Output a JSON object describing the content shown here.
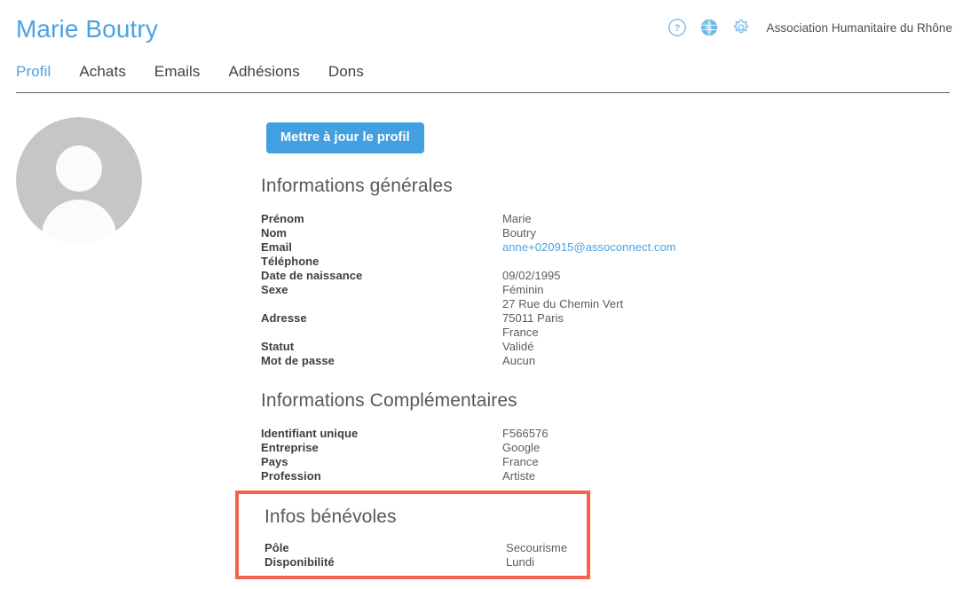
{
  "header": {
    "title": "Marie Boutry",
    "org_name": "Association Humanitaire du Rhône",
    "icons": [
      {
        "name": "help-icon",
        "label": "?"
      },
      {
        "name": "globe-icon",
        "label": "globe"
      },
      {
        "name": "gear-icon",
        "label": "settings"
      }
    ],
    "accent_color": "#4ba2e2",
    "divider_color": "#5a5a5a"
  },
  "tabs": [
    {
      "label": "Profil",
      "active": true
    },
    {
      "label": "Achats",
      "active": false
    },
    {
      "label": "Emails",
      "active": false
    },
    {
      "label": "Adhésions",
      "active": false
    },
    {
      "label": "Dons",
      "active": false
    }
  ],
  "avatar": {
    "name": "avatar-placeholder",
    "background_color": "#c6c6c6",
    "silhouette_color": "#ffffff"
  },
  "actions": {
    "update_profile_label": "Mettre à jour le profil",
    "button_color": "#43a0e0"
  },
  "sections": [
    {
      "id": "informations-generales",
      "title": "Informations générales",
      "fields": [
        {
          "label": "Prénom",
          "value": "Marie",
          "type": "text"
        },
        {
          "label": "Nom",
          "value": "Boutry",
          "type": "text"
        },
        {
          "label": "Email",
          "value": "anne+020915@assoconnect.com",
          "type": "link"
        },
        {
          "label": "Téléphone",
          "value": "",
          "type": "text"
        },
        {
          "label": "Date de naissance",
          "value": "09/02/1995",
          "type": "text"
        },
        {
          "label": "Sexe",
          "value": "Féminin",
          "type": "text"
        },
        {
          "label": "Adresse",
          "value": "27 Rue du Chemin Vert\n75011 Paris\nFrance",
          "type": "multiline"
        },
        {
          "label": "Statut",
          "value": "Validé",
          "type": "text"
        },
        {
          "label": "Mot de passe",
          "value": "Aucun",
          "type": "text"
        }
      ]
    },
    {
      "id": "informations-complementaires",
      "title": "Informations Complémentaires",
      "fields": [
        {
          "label": "Identifiant unique",
          "value": "F566576",
          "type": "text"
        },
        {
          "label": "Entreprise",
          "value": "Google",
          "type": "text"
        },
        {
          "label": "Pays",
          "value": "France",
          "type": "text"
        },
        {
          "label": "Profession",
          "value": "Artiste",
          "type": "text"
        }
      ]
    }
  ],
  "volunteer_section": {
    "id": "infos-benevoles",
    "title": "Infos bénévoles",
    "highlight_color": "#f4634f",
    "fields": [
      {
        "label": "Pôle",
        "value": "Secourisme",
        "type": "text"
      },
      {
        "label": "Disponibilité",
        "value": "Lundi",
        "type": "text"
      }
    ]
  }
}
